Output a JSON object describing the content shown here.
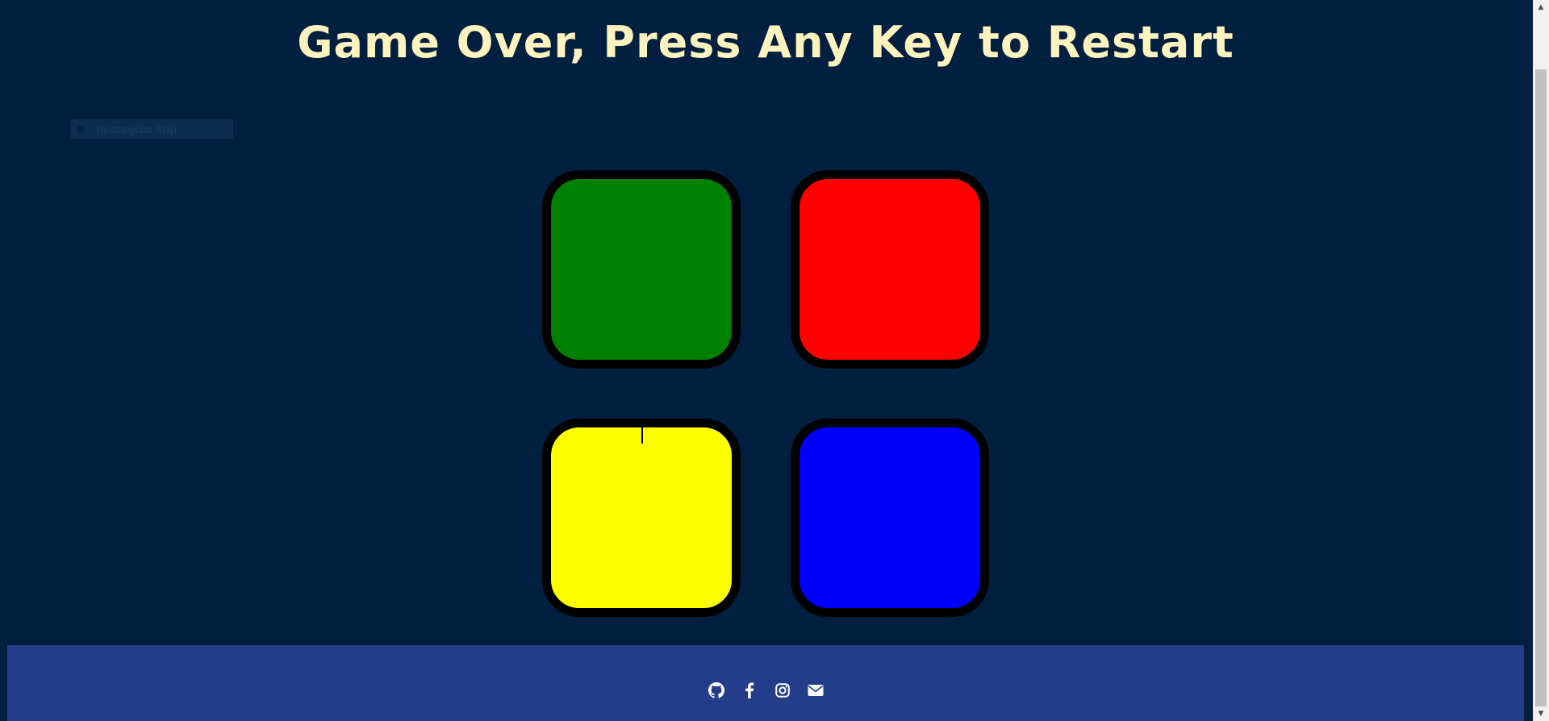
{
  "title": "Game Over, Press Any Key to Restart",
  "snip_overlay": {
    "label": "Rectangular Snip",
    "icon": "snip-dot-icon"
  },
  "buttons": [
    {
      "id": "green",
      "color": "#008000"
    },
    {
      "id": "red",
      "color": "#ff0000"
    },
    {
      "id": "yellow",
      "color": "#ffff00"
    },
    {
      "id": "blue",
      "color": "#0000ff"
    }
  ],
  "footer": {
    "icons": [
      "github-icon",
      "facebook-icon",
      "instagram-icon",
      "envelope-icon"
    ]
  },
  "colors": {
    "background": "#011f3f",
    "title": "#fef2bf",
    "footer": "#233d8a",
    "button_border": "#000000"
  },
  "scrollbar": {
    "up_glyph": "▲",
    "down_glyph": "▼"
  }
}
